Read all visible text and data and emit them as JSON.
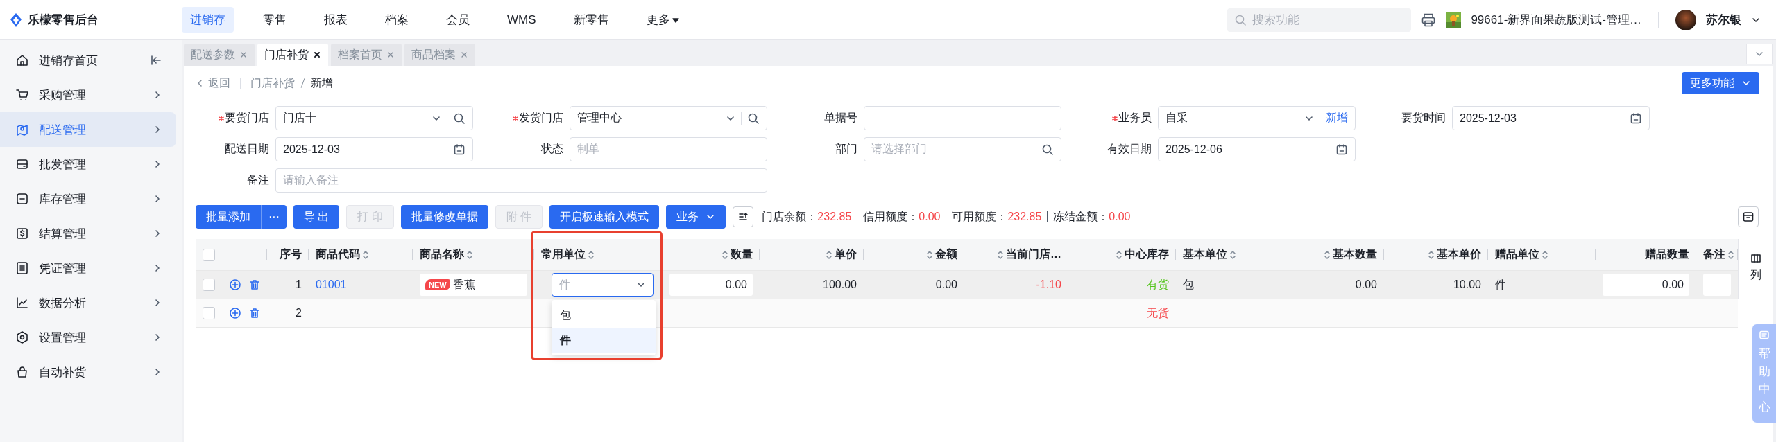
{
  "app": {
    "title": "乐檬零售后台"
  },
  "top_nav": [
    {
      "label": "进销存",
      "selected": true,
      "kind": "link"
    },
    {
      "label": "零售",
      "selected": false,
      "kind": "link"
    },
    {
      "label": "报表",
      "selected": false,
      "kind": "link"
    },
    {
      "label": "档案",
      "selected": false,
      "kind": "link"
    },
    {
      "label": "会员",
      "selected": false,
      "kind": "link"
    },
    {
      "label": "WMS",
      "selected": false,
      "kind": "link"
    },
    {
      "label": "新零售",
      "selected": false,
      "kind": "link"
    },
    {
      "label": "更多",
      "selected": false,
      "kind": "menu"
    }
  ],
  "search": {
    "placeholder": "搜索功能"
  },
  "store": {
    "name": "99661-新界面果蔬版测试-管理…"
  },
  "user": {
    "name": "苏尔银"
  },
  "sidebar": {
    "items": [
      {
        "label": "进销存首页",
        "selected": false
      },
      {
        "label": "采购管理",
        "selected": false
      },
      {
        "label": "配送管理",
        "selected": true
      },
      {
        "label": "批发管理",
        "selected": false
      },
      {
        "label": "库存管理",
        "selected": false
      },
      {
        "label": "结算管理",
        "selected": false
      },
      {
        "label": "凭证管理",
        "selected": false
      },
      {
        "label": "数据分析",
        "selected": false
      },
      {
        "label": "设置管理",
        "selected": false
      },
      {
        "label": "自动补货",
        "selected": false
      }
    ]
  },
  "tabs": [
    {
      "label": "配送参数",
      "selected": false
    },
    {
      "label": "门店补货",
      "selected": true
    },
    {
      "label": "档案首页",
      "selected": false
    },
    {
      "label": "商品档案",
      "selected": false
    }
  ],
  "breadcrumb": {
    "back": "返回",
    "items": [
      "门店补货",
      "新增"
    ]
  },
  "more_button": {
    "label": "更多功能"
  },
  "form": {
    "rows": [
      [
        {
          "label": "要货门店",
          "required": true,
          "kind": "select-search",
          "value": "门店十"
        },
        {
          "label": "发货门店",
          "required": true,
          "kind": "select-search",
          "value": "管理中心"
        },
        {
          "label": "单据号",
          "required": false,
          "kind": "text"
        },
        {
          "label": "业务员",
          "required": true,
          "kind": "select-add",
          "value": "自采",
          "action": "新增"
        },
        {
          "label": "要货时间",
          "required": false,
          "kind": "date",
          "value": "2025-12-03"
        }
      ],
      [
        {
          "label": "配送日期",
          "required": false,
          "kind": "date",
          "value": "2025-12-03"
        },
        {
          "label": "状态",
          "required": false,
          "kind": "text",
          "placeholder": "制单"
        },
        {
          "label": "部门",
          "required": false,
          "kind": "search",
          "placeholder": "请选择部门"
        },
        {
          "label": "有效日期",
          "required": false,
          "kind": "date",
          "value": "2025-12-06"
        }
      ],
      [
        {
          "label": "备注",
          "required": false,
          "kind": "note",
          "placeholder": "请输入备注"
        }
      ]
    ]
  },
  "toolbar": {
    "buttons": [
      {
        "label": "批量添加",
        "kind": "split",
        "menu": "···",
        "disabled": false
      },
      {
        "label": "导 出",
        "kind": "primary",
        "disabled": false
      },
      {
        "label": "打 印",
        "kind": "primary",
        "disabled": true
      },
      {
        "label": "批量修改单据",
        "kind": "primary",
        "disabled": false
      },
      {
        "label": "附 件",
        "kind": "primary",
        "disabled": true
      },
      {
        "label": "开启极速输入模式",
        "kind": "primary",
        "disabled": false
      },
      {
        "label": "业务",
        "kind": "dropdown",
        "disabled": false
      }
    ],
    "balances": [
      {
        "label": "门店余额：",
        "value": "232.85"
      },
      {
        "label": "信用额度：",
        "value": "0.00"
      },
      {
        "label": "可用额度：",
        "value": "232.85"
      },
      {
        "label": "冻结金额：",
        "value": "0.00"
      }
    ]
  },
  "table": {
    "all_checked": false,
    "columns": [
      {
        "label": "序号",
        "sortable": false,
        "kind": "text"
      },
      {
        "label": "商品代码",
        "sortable": true,
        "kind": "link"
      },
      {
        "label": "商品名称",
        "sortable": true,
        "kind": "product"
      },
      {
        "label": "常用单位",
        "sortable": true,
        "kind": "select"
      },
      {
        "label": "数量",
        "sortable": true,
        "kind": "input"
      },
      {
        "label": "单价",
        "sortable": true,
        "kind": "text"
      },
      {
        "label": "金额",
        "sortable": true,
        "kind": "text"
      },
      {
        "label": "当前门店…",
        "sortable": true,
        "kind": "text"
      },
      {
        "label": "中心库存",
        "sortable": true,
        "kind": "status"
      },
      {
        "label": "基本单位",
        "sortable": true,
        "kind": "text"
      },
      {
        "label": "基本数量",
        "sortable": true,
        "kind": "text"
      },
      {
        "label": "基本单价",
        "sortable": true,
        "kind": "text"
      },
      {
        "label": "赠品单位",
        "sortable": true,
        "kind": "text"
      },
      {
        "label": "赠品数量",
        "sortable": false,
        "kind": "input"
      },
      {
        "label": "备注",
        "sortable": true,
        "kind": "input"
      }
    ],
    "rows": [
      {
        "checked": false,
        "editing": true,
        "cells": [
          "1",
          "01001",
          {
            "badge": "NEW",
            "text": "香蕉"
          },
          "件",
          "0.00",
          "100.00",
          "0.00",
          {
            "text": "-1.10",
            "alert": true
          },
          {
            "text": "有货",
            "alert": false
          },
          "包",
          "0.00",
          "10.00",
          "件",
          "0.00",
          null
        ]
      },
      {
        "checked": false,
        "editing": false,
        "cells": [
          "2",
          null,
          null,
          null,
          null,
          null,
          null,
          null,
          {
            "text": "无货",
            "alert": true
          },
          null,
          null,
          null,
          null,
          null,
          null
        ]
      }
    ],
    "unit_dropdown": {
      "open": true,
      "options": [
        {
          "label": "包",
          "selected": false
        },
        {
          "label": "件",
          "selected": true
        }
      ]
    },
    "column_settings": {
      "label": "列"
    }
  },
  "annotation": {
    "kind": "highlight-box"
  },
  "help": {
    "label": "帮助中心"
  }
}
